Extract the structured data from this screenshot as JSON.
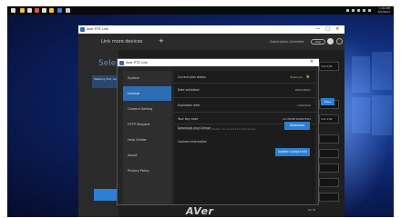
{
  "taskbar": {
    "clock_time": "1:01 PM",
    "clock_date": "3/5/2021"
  },
  "app": {
    "title": "Aver PTZ Link",
    "window_controls": [
      "—",
      "□",
      "×"
    ],
    "header": {
      "link_more": "Link more devices",
      "subscription": "Subscription: Unlimited",
      "help": "Help"
    },
    "select_heading": "Selecti",
    "meeting_item": "Meeting Hall, Aver PT",
    "logo": "AVer",
    "right_column": [
      "192.168.",
      "Save",
      "192.168.",
      "192.168."
    ],
    "pager": "Go To"
  },
  "dialog": {
    "title": "Aver PTZ Link",
    "nav": [
      {
        "label": "System",
        "active": false
      },
      {
        "label": "License",
        "active": true
      },
      {
        "label": "Camera Setting",
        "active": false
      },
      {
        "label": "HTTP Request",
        "active": false
      },
      {
        "label": "Help Center",
        "active": false
      },
      {
        "label": "About",
        "active": false
      },
      {
        "label": "Privacy Policy",
        "active": false
      }
    ],
    "rows": [
      {
        "label": "Current plan status",
        "value": "Premium"
      },
      {
        "label": "Date activated",
        "value": "03/01/2021"
      },
      {
        "label": "Expiration date",
        "value": "Unlimited"
      },
      {
        "label": "Your key code",
        "value": "SCUBQBTDAB0TEGS"
      },
      {
        "label": "Download your license",
        "value": ""
      },
      {
        "label": "Contact information",
        "value": ""
      }
    ],
    "download_desc": "Download your license for offline activation. You can share it to other devices.",
    "download_button": "Download",
    "update_button": "Update Contact Info"
  },
  "colors": {
    "accent": "#2d7fd5",
    "nav_active": "#2d6eb3",
    "premium": "#e0c040"
  }
}
